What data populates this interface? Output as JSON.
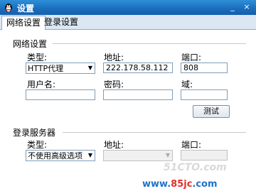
{
  "window": {
    "title": "设置",
    "close_label": "×",
    "minimize_label": "_"
  },
  "tabs": [
    {
      "label": "网络设置"
    },
    {
      "label": "登录设置"
    }
  ],
  "network": {
    "section_title": "网络设置",
    "type_label": "类型:",
    "type_value": "HTTP代理",
    "address_label": "地址:",
    "address_value": "222.178.58.112",
    "port_label": "端口:",
    "port_value": "808",
    "username_label": "用户名:",
    "username_value": "",
    "password_label": "密码:",
    "password_value": "",
    "domain_label": "域:",
    "domain_value": "",
    "test_button": "测试"
  },
  "login_server": {
    "section_title": "登录服务器",
    "type_label": "类型:",
    "type_value": "不使用高级选项",
    "address_label": "地址:",
    "address_value": "",
    "port_label": "端口:",
    "port_value": ""
  },
  "watermark": {
    "site1": "51CTO.com",
    "site2_prefix": "www.",
    "site2_brand": "85jc",
    "site2_suffix": ".com"
  },
  "colors": {
    "titlebar": "#1b6fbe",
    "field_border": "#7f9db9"
  }
}
